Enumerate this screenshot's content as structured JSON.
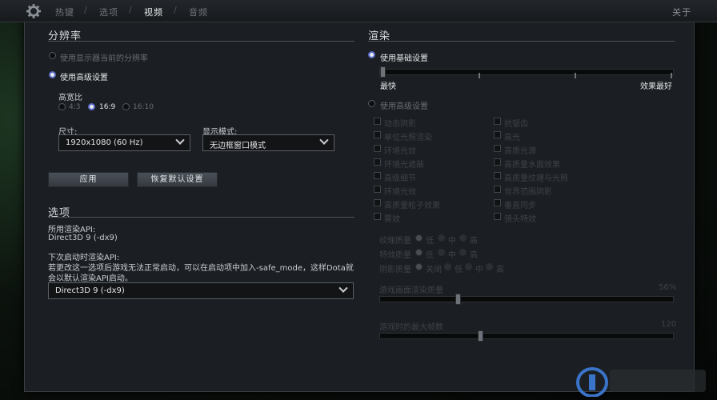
{
  "tabs": [
    {
      "label": "热键"
    },
    {
      "label": "选项"
    },
    {
      "label": "视频"
    },
    {
      "label": "音频"
    }
  ],
  "tab_separator": "/",
  "close_label": "关于",
  "resolution": {
    "title": "分辨率",
    "use_display_current": "使用显示器当前的分辨率",
    "use_advanced": "使用高级设置",
    "aspect_title": "高宽比",
    "aspect_options": [
      "4:3",
      "16:9",
      "16:10"
    ],
    "aspect_selected": "16:9",
    "size_label": "尺寸:",
    "size_value": "1920x1080 (60 Hz)",
    "display_mode_label": "显示模式:",
    "display_mode_value": "无边框窗口模式",
    "apply_label": "应用",
    "restore_label": "恢复默认设置"
  },
  "options": {
    "title": "选项",
    "render_api_label": "所用渲染API:",
    "render_api_value": "Direct3D 9 (-dx9)",
    "next_api_label": "下次启动时渲染API:",
    "next_api_note_1": "若更改这一选项后游戏无法正常启动，可以在启动项中加入-safe_mode，这样Dota就",
    "next_api_note_2": "会以默认渲染API启动。",
    "next_api_value": "Direct3D 9 (-dx9)"
  },
  "render": {
    "title": "渲染",
    "use_basic": "使用基础设置",
    "basic_min_label": "最快",
    "basic_max_label": "效果最好",
    "basic_level": 0.0,
    "use_advanced": "使用高级设置",
    "checkboxes_left": [
      "动态阴影",
      "单位光照渲染",
      "环境光效",
      "环境光遮蔽",
      "高级细节",
      "环境光效",
      "高质量粒子效果",
      "雾效"
    ],
    "checkboxes_right": [
      "抗锯齿",
      "高光",
      "高质光源",
      "高质量水面效果",
      "高质量纹理与光照",
      "世界范围阴影",
      "垂直同步",
      "镜头特效"
    ],
    "texture_label": "纹理质量",
    "effects_label": "特效质量",
    "shadow_label": "阴影质量",
    "quality_options": [
      "低",
      "中",
      "高"
    ],
    "shadow_options": [
      "关闭",
      "低",
      "中",
      "高",
      "超高"
    ],
    "screen_render_label": "游戏画面渲染质量",
    "screen_render_value": "56%",
    "screen_render_level": 0.56,
    "fps_label": "游戏时的最大帧数",
    "fps_value": "120",
    "fps_level": 0.07
  },
  "colors": {
    "accent_blue": "#5a6cc9",
    "panel_bg": "#1b1e22"
  }
}
